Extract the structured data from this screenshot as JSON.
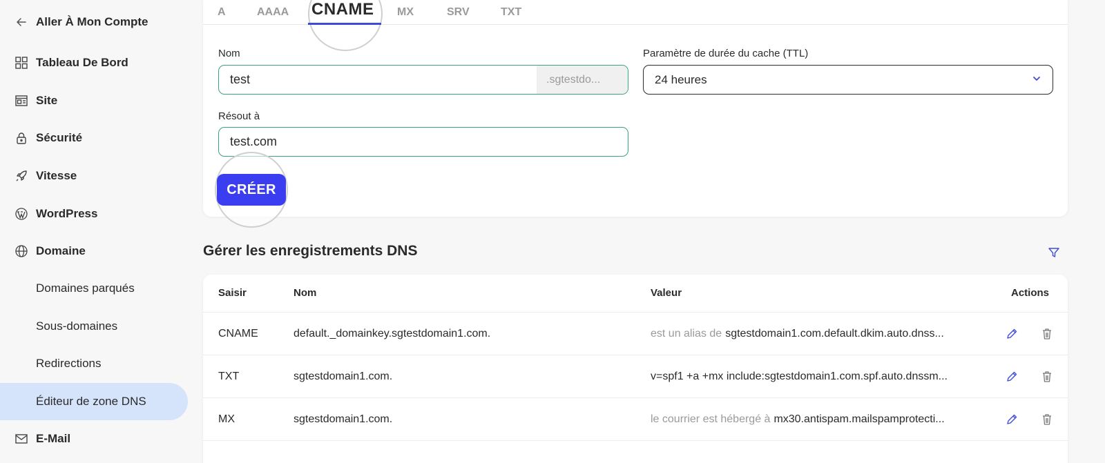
{
  "sidebar": {
    "back_label": "Aller À Mon Compte",
    "items": [
      {
        "label": "Tableau De Bord",
        "icon": "dashboard-grid-icon"
      },
      {
        "label": "Site",
        "icon": "site-layout-icon"
      },
      {
        "label": "Sécurité",
        "icon": "lock-icon"
      },
      {
        "label": "Vitesse",
        "icon": "rocket-icon"
      },
      {
        "label": "WordPress",
        "icon": "wordpress-icon"
      },
      {
        "label": "Domaine",
        "icon": "globe-icon"
      }
    ],
    "sub_items": [
      {
        "label": "Domaines parqués"
      },
      {
        "label": "Sous-domaines"
      },
      {
        "label": "Redirections"
      },
      {
        "label": "Éditeur de zone DNS",
        "active": true
      }
    ],
    "email_label": "E-Mail"
  },
  "record_tabs": {
    "tabs": [
      "A",
      "AAAA",
      "CNAME",
      "MX",
      "SRV",
      "TXT"
    ],
    "active": "CNAME"
  },
  "form": {
    "name_label": "Nom",
    "name_value": "test",
    "name_suffix": ".sgtestdo...",
    "ttl_label": "Paramètre de durée du cache (TTL)",
    "ttl_value": "24 heures",
    "resolves_label": "Résout à",
    "resolves_value": "test.com",
    "create_label": "CRÉER"
  },
  "records": {
    "title": "Gérer les enregistrements DNS",
    "columns": [
      "Saisir",
      "Nom",
      "Valeur",
      "Actions"
    ],
    "rows": [
      {
        "type": "CNAME",
        "name": "default._domainkey.sgtestdomain1.com.",
        "value_prefix": "est un alias de",
        "value": "sgtestdomain1.com.default.dkim.auto.dnss..."
      },
      {
        "type": "TXT",
        "name": "sgtestdomain1.com.",
        "value_prefix": "",
        "value": "v=spf1 +a +mx include:sgtestdomain1.com.spf.auto.dnssm..."
      },
      {
        "type": "MX",
        "name": "sgtestdomain1.com.",
        "value_prefix": "le courrier est hébergé à",
        "value": "mx30.antispam.mailspamprotecti..."
      }
    ]
  },
  "colors": {
    "accent": "#3a3df0",
    "active_nav_bg": "#d6e4fb",
    "input_border_valid": "#3aa37a",
    "muted_text": "#9a9a9a"
  }
}
